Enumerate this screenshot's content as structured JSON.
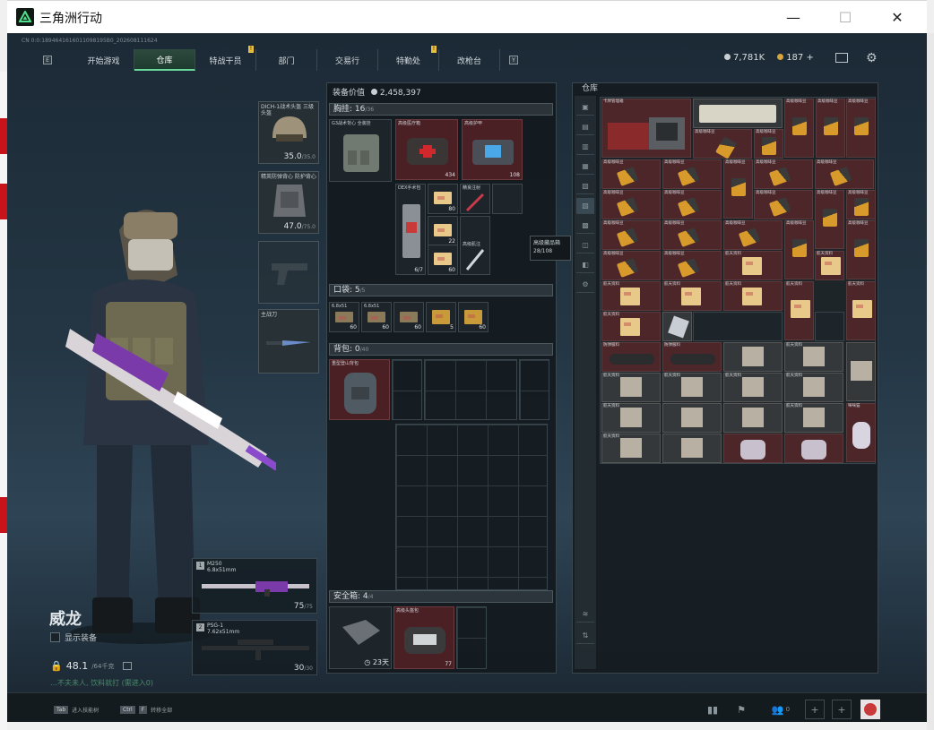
{
  "window": {
    "title": "三角洲行动",
    "minimize": "—",
    "maximize": "☐",
    "close": "✕"
  },
  "uid": "CN 0:0:1894641616011098195B0_202608111624",
  "nav": {
    "left_key": "E",
    "right_key": "Y",
    "tabs": [
      {
        "label": "开始游戏",
        "active": false,
        "notif": ""
      },
      {
        "label": "仓库",
        "active": true,
        "notif": ""
      },
      {
        "label": "特战干员",
        "active": false,
        "notif": "!"
      },
      {
        "label": "部门",
        "active": false,
        "notif": ""
      },
      {
        "label": "交易行",
        "active": false,
        "notif": ""
      },
      {
        "label": "特勤处",
        "active": false,
        "notif": "!"
      },
      {
        "label": "改枪台",
        "active": false,
        "notif": ""
      }
    ]
  },
  "currency": {
    "hafcoin": "7,781K",
    "bond": "187",
    "bond_plus": "+"
  },
  "operator": {
    "name": "威龙",
    "show_equip": "显示装备",
    "weight": "48.1",
    "weight_max": "/64千克",
    "hint": "…不夫未人, 饮料就打 (需进入0)"
  },
  "gear": {
    "helmet": {
      "label": "DICH-1战术头盔 三级头盔",
      "dur": "35.0",
      "max": "/35.0"
    },
    "armor": {
      "label": "精英防弹背心 防护背心",
      "dur": "47.0",
      "max": "/75.0"
    },
    "melee": {
      "label": "主战刀"
    },
    "weapons": [
      {
        "slot": "1",
        "name": "M250",
        "caliber": "6.8x51mm",
        "ammo": "75",
        "max": "/75"
      },
      {
        "slot": "2",
        "name": "PSG-1",
        "caliber": "7.62x51mm",
        "ammo": "30",
        "max": "/30"
      }
    ]
  },
  "equip_panel": {
    "value_label": "装备价值",
    "value": "2,458,397",
    "chest_label": "胸挂",
    "chest_count": "16",
    "chest_max": "/36",
    "pocket_label": "口袋",
    "pocket_count": "5",
    "pocket_max": "/5",
    "backpack_label": "背包",
    "backpack_count": "0",
    "backpack_max": "/40",
    "safe_label": "安全箱",
    "safe_count": "4",
    "safe_max": "/4",
    "safe_timer": "23天",
    "chest_items": [
      {
        "label": "G3战术背心 全装挂",
        "cnt": ""
      },
      {
        "label": "高级医疗箱",
        "cnt": "434"
      },
      {
        "label": "高级护甲",
        "cnt": "108"
      },
      {
        "label": "DEX手术包",
        "cnt": "6/7"
      },
      {
        "label": "",
        "cnt": "80"
      },
      {
        "label": "",
        "cnt": "22"
      },
      {
        "label": "精良注射",
        "cnt": ""
      },
      {
        "label": "",
        "cnt": "60"
      },
      {
        "label": "高级肌注",
        "cnt": ""
      }
    ],
    "pocket_items": [
      {
        "label": "6.8x51",
        "cnt": "60"
      },
      {
        "label": "6.8x51",
        "cnt": "60"
      },
      {
        "label": "",
        "cnt": "60"
      },
      {
        "label": "",
        "cnt": "5"
      },
      {
        "label": "",
        "cnt": "60"
      }
    ],
    "backpack_item": "重型登山背包",
    "safe_item": "高级头盔包",
    "safe_item_cnt": "77"
  },
  "tooltip": {
    "line1": "高级藏品箱",
    "line2": "28/108"
  },
  "stash": {
    "title": "仓库",
    "top_labels": [
      "卡牌管理箱",
      "高级咖啡豆",
      "高级咖啡豆",
      "高级咖啡豆"
    ],
    "coffee_label": "高级咖啡豆",
    "doc_label": "航天资料",
    "map_label": "航天资料",
    "misc_labels": [
      "防弹服料",
      "航天资料",
      "浅蓝玩偶",
      "咪咪猫"
    ]
  },
  "bottom": {
    "tab_key": "Tab",
    "tab_label": "进入技能树",
    "ctrl_key": "Ctrl",
    "f_key": "F",
    "ctrl_label": "转移全部",
    "friends": "0"
  }
}
